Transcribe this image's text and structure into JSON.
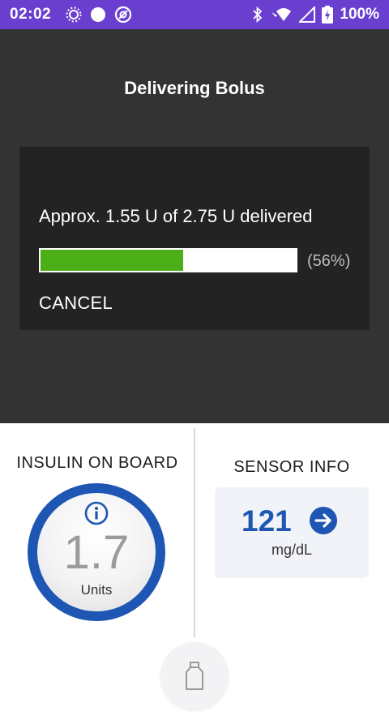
{
  "status_bar": {
    "time": "02:02",
    "battery_pct": "100%",
    "left_icons": [
      "brightness-icon",
      "circle-icon",
      "app-notification-icon"
    ],
    "right_icons": [
      "bluetooth-icon",
      "wifi-icon",
      "signal-icon",
      "battery-icon"
    ],
    "background": "#6a3fd0"
  },
  "header": {
    "title": "Delivering Bolus"
  },
  "dialog": {
    "message": "Approx. 1.55 U of 2.75 U delivered",
    "progress_fraction": 0.56,
    "progress_label": "(56%)",
    "cancel_label": "CANCEL",
    "progress_color": "#4caf18"
  },
  "insulin_on_board": {
    "title": "INSULIN ON BOARD",
    "value": "1.7",
    "unit": "Units",
    "ring_color": "#1e56b4"
  },
  "sensor_info": {
    "title": "SENSOR INFO",
    "value": "121",
    "unit": "mg/dL",
    "value_color": "#1e56b4"
  },
  "bolus_button": {
    "icon": "insulin-vial-icon"
  }
}
